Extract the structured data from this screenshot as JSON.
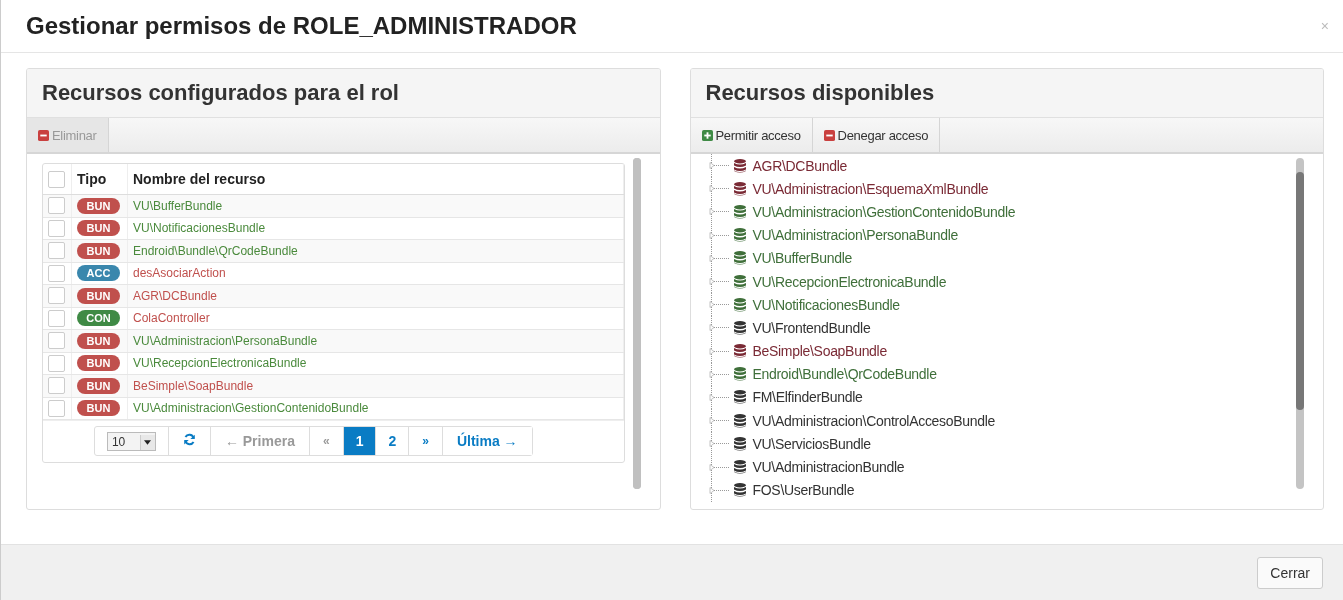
{
  "dialog": {
    "title": "Gestionar permisos de ROLE_ADMINISTRADOR",
    "close": "×"
  },
  "left_panel": {
    "title": "Recursos configurados para el rol",
    "toolbar": [
      {
        "label": "Eliminar",
        "kind": "remove",
        "disabled": true
      }
    ],
    "columns": [
      "Tipo",
      "Nombre del recurso"
    ],
    "header_checked": false,
    "rows": [
      {
        "checked": false,
        "badge": {
          "text": "BUN",
          "color": "#c0504d"
        },
        "name": {
          "text": "VU\\BufferBundle",
          "color": "#4a8a3c"
        }
      },
      {
        "checked": false,
        "badge": {
          "text": "BUN",
          "color": "#c0504d"
        },
        "name": {
          "text": "VU\\NotificacionesBundle",
          "color": "#4a8a3c"
        }
      },
      {
        "checked": false,
        "badge": {
          "text": "BUN",
          "color": "#c0504d"
        },
        "name": {
          "text": "Endroid\\Bundle\\QrCodeBundle",
          "color": "#4a8a3c"
        }
      },
      {
        "checked": false,
        "badge": {
          "text": "ACC",
          "color": "#3a87ad"
        },
        "name": {
          "text": "desAsociarAction",
          "color": "#c0504d"
        }
      },
      {
        "checked": false,
        "badge": {
          "text": "BUN",
          "color": "#c0504d"
        },
        "name": {
          "text": "AGR\\DCBundle",
          "color": "#c0504d"
        }
      },
      {
        "checked": false,
        "badge": {
          "text": "CON",
          "color": "#3f8a45"
        },
        "name": {
          "text": "ColaController",
          "color": "#c0504d"
        }
      },
      {
        "checked": false,
        "badge": {
          "text": "BUN",
          "color": "#c0504d"
        },
        "name": {
          "text": "VU\\Administracion\\PersonaBundle",
          "color": "#4a8a3c"
        }
      },
      {
        "checked": false,
        "badge": {
          "text": "BUN",
          "color": "#c0504d"
        },
        "name": {
          "text": "VU\\RecepcionElectronicaBundle",
          "color": "#4a8a3c"
        }
      },
      {
        "checked": false,
        "badge": {
          "text": "BUN",
          "color": "#c0504d"
        },
        "name": {
          "text": "BeSimple\\SoapBundle",
          "color": "#c0504d"
        }
      },
      {
        "checked": false,
        "badge": {
          "text": "BUN",
          "color": "#c0504d"
        },
        "name": {
          "text": "VU\\Administracion\\GestionContenidoBundle",
          "color": "#4a8a3c"
        }
      }
    ],
    "pagination": {
      "page_size": "10",
      "first": {
        "label": "← Primera",
        "disabled": true
      },
      "prev": {
        "label": "«",
        "disabled": true
      },
      "pages": [
        {
          "label": "1",
          "selected": true
        },
        {
          "label": "2",
          "selected": false
        }
      ],
      "next": {
        "label": "»",
        "disabled": false
      },
      "last": {
        "label": "Última →",
        "disabled": false
      }
    }
  },
  "right_panel": {
    "title": "Recursos disponibles",
    "toolbar": [
      {
        "label": "Permitir acceso",
        "kind": "add",
        "disabled": false
      },
      {
        "label": "Denegar acceso",
        "kind": "remove",
        "disabled": false
      }
    ],
    "tree": [
      {
        "name": "AGR\\DCBundle",
        "color": "#7a2a35"
      },
      {
        "name": "VU\\Administracion\\EsquemaXmlBundle",
        "color": "#7a2a35"
      },
      {
        "name": "VU\\Administracion\\GestionContenidoBundle",
        "color": "#3f6f3a"
      },
      {
        "name": "VU\\Administracion\\PersonaBundle",
        "color": "#3f6f3a"
      },
      {
        "name": "VU\\BufferBundle",
        "color": "#3f6f3a"
      },
      {
        "name": "VU\\RecepcionElectronicaBundle",
        "color": "#3f6f3a"
      },
      {
        "name": "VU\\NotificacionesBundle",
        "color": "#3f6f3a"
      },
      {
        "name": "VU\\FrontendBundle",
        "color": "#333333"
      },
      {
        "name": "BeSimple\\SoapBundle",
        "color": "#7a2a35"
      },
      {
        "name": "Endroid\\Bundle\\QrCodeBundle",
        "color": "#3f6f3a"
      },
      {
        "name": "FM\\ElfinderBundle",
        "color": "#333333"
      },
      {
        "name": "VU\\Administracion\\ControlAccesoBundle",
        "color": "#333333"
      },
      {
        "name": "VU\\ServiciosBundle",
        "color": "#333333"
      },
      {
        "name": "VU\\AdministracionBundle",
        "color": "#333333"
      },
      {
        "name": "FOS\\UserBundle",
        "color": "#333333"
      }
    ]
  },
  "footer": {
    "button": "Cerrar"
  }
}
